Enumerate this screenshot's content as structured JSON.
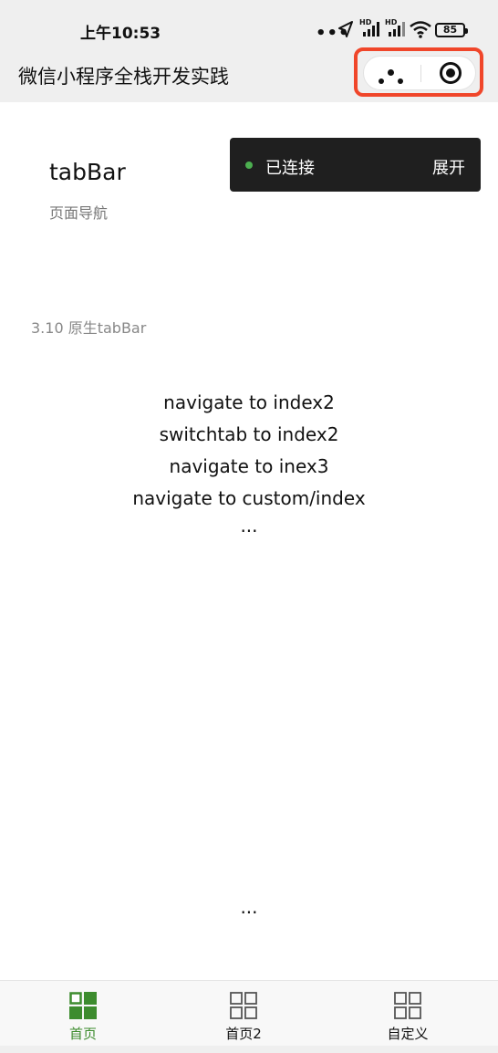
{
  "status_bar": {
    "time": "上午10:53",
    "battery": "85",
    "icons": [
      "more-dots-icon",
      "location-arrow-icon",
      "signal-hd-icon",
      "signal-hd-icon",
      "wifi-icon",
      "battery-icon"
    ]
  },
  "nav": {
    "title": "微信小程序全栈开发实践",
    "capsule_highlight_color": "#f0462a"
  },
  "toast": {
    "status": "已连接",
    "expand_label": "展开",
    "status_color": "#4caf50"
  },
  "page": {
    "heading": "tabBar",
    "subheading": "页面导航",
    "section_label": "3.10 原生tabBar",
    "links": [
      "navigate to index2",
      "switchtab to index2",
      "navigate to inex3",
      "navigate to custom/index"
    ],
    "ellipsis_top": "...",
    "ellipsis_bottom": "..."
  },
  "tab_bar": {
    "active_color": "#3d8c2e",
    "items": [
      {
        "label": "首页",
        "active": true
      },
      {
        "label": "首页2",
        "active": false
      },
      {
        "label": "自定义",
        "active": false
      }
    ]
  }
}
